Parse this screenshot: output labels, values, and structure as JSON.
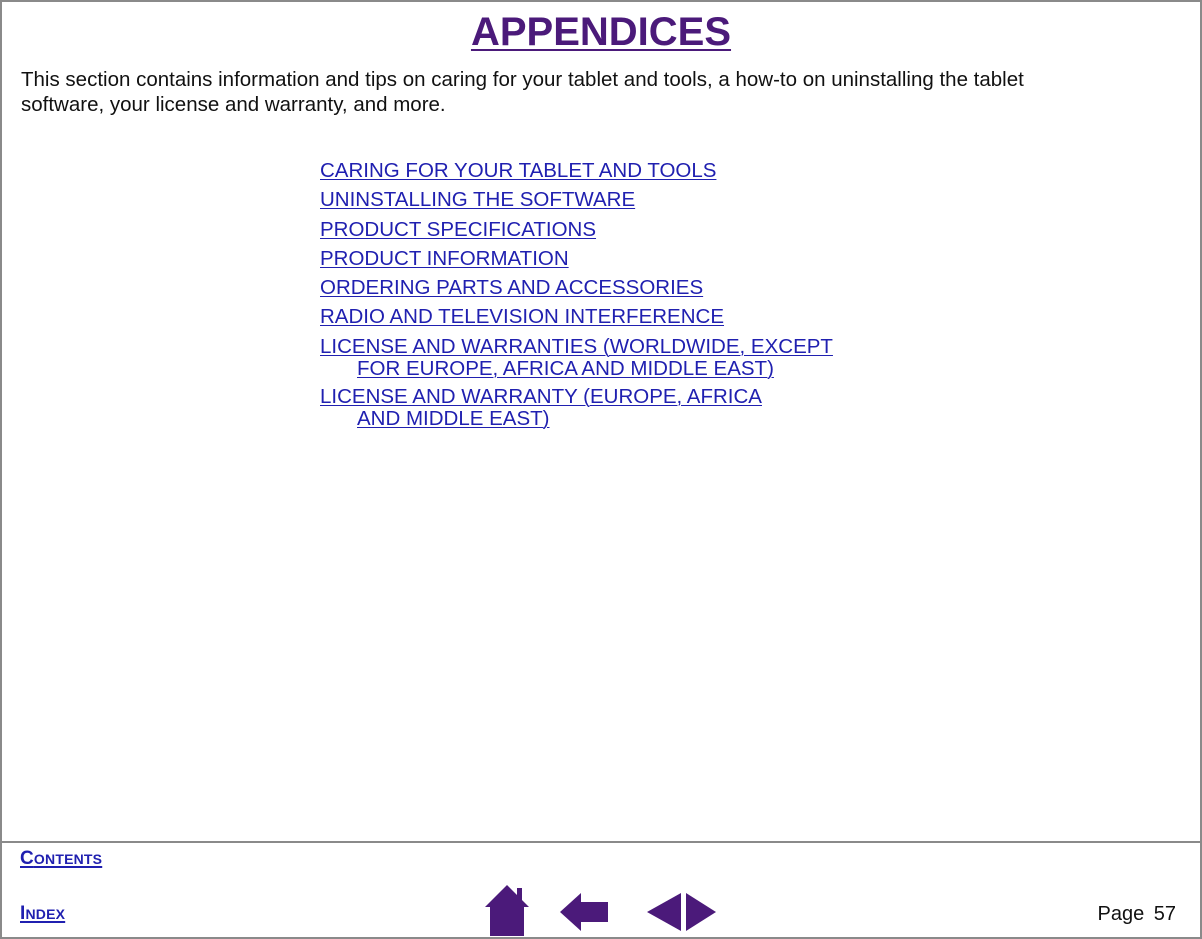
{
  "title": "APPENDICES",
  "intro_line1": "This section contains information and tips on caring for your tablet and tools, a how-to on uninstalling the tablet",
  "intro_line2": "software, your license and warranty, and more.",
  "links": [
    {
      "label": "CARING FOR YOUR TABLET AND TOOLS"
    },
    {
      "label": "UNINSTALLING THE SOFTWARE"
    },
    {
      "label": "PRODUCT SPECIFICATIONS"
    },
    {
      "label": "PRODUCT INFORMATION"
    },
    {
      "label": "ORDERING PARTS AND ACCESSORIES"
    },
    {
      "label": "RADIO AND TELEVISION INTERFERENCE"
    },
    {
      "label_line1": "LICENSE AND WARRANTIES (WORLDWIDE, EXCEPT ",
      "label_line2": "FOR EUROPE, AFRICA AND MIDDLE EAST)"
    },
    {
      "label_line1": "LICENSE AND WARRANTY (EUROPE, AFRICA ",
      "label_line2": "AND MIDDLE EAST)"
    }
  ],
  "footer": {
    "contents_first": "C",
    "contents_rest": "ONTENTS",
    "index_first": "I",
    "index_rest": "NDEX",
    "page_label": "Page 57",
    "icons": [
      "home-icon",
      "back-arrow-icon",
      "previous-page-icon",
      "next-page-icon"
    ]
  },
  "colors": {
    "title": "#4b1a7a",
    "link": "#2020b0",
    "nav_icon": "#4b1a7a",
    "border": "#8a8a8a"
  }
}
